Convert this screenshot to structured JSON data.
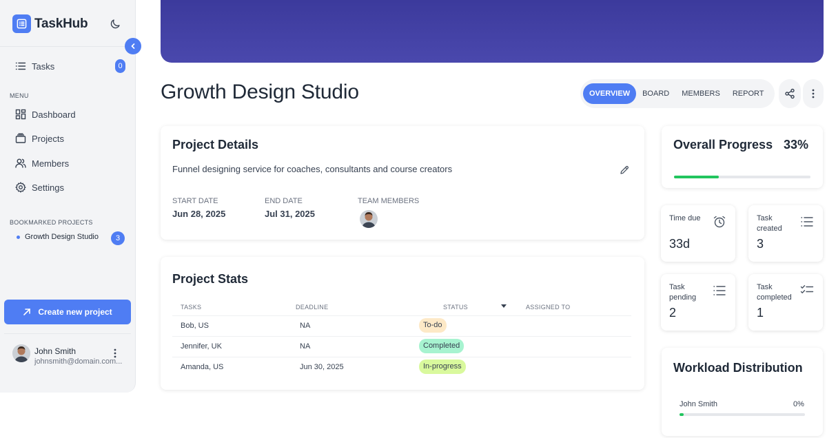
{
  "app": {
    "name": "TaskHub"
  },
  "sidebar": {
    "tasks": {
      "label": "Tasks",
      "count": "0"
    },
    "menu_label": "MENU",
    "menu_items": [
      {
        "label": "Dashboard",
        "icon": "dashboard-icon"
      },
      {
        "label": "Projects",
        "icon": "folder-icon"
      },
      {
        "label": "Members",
        "icon": "users-icon"
      },
      {
        "label": "Settings",
        "icon": "gear-icon"
      }
    ],
    "bookmarked_label": "BOOKMARKED PROJECTS",
    "bookmarks": [
      {
        "label": "Growth Design Studio",
        "count": "3"
      }
    ],
    "create_button": "Create new project",
    "user": {
      "name": "John Smith",
      "email": "johnsmith@domain.com..."
    }
  },
  "header": {
    "title": "Growth Design Studio",
    "tabs": [
      "OVERVIEW",
      "BOARD",
      "MEMBERS",
      "REPORT"
    ],
    "active_tab": "OVERVIEW"
  },
  "project_details": {
    "title": "Project Details",
    "description": "Funnel designing service for coaches, consultants and course creators",
    "start_label": "START DATE",
    "start_value": "Jun 28, 2025",
    "end_label": "END DATE",
    "end_value": "Jul 31, 2025",
    "team_label": "TEAM MEMBERS"
  },
  "project_stats": {
    "title": "Project Stats",
    "columns": [
      "TASKS",
      "DEADLINE",
      "STATUS",
      "ASSIGNED TO"
    ],
    "rows": [
      {
        "task": "Bob, US",
        "deadline": "NA",
        "status": "To-do",
        "status_color": "#fde9c7"
      },
      {
        "task": "Jennifer, UK",
        "deadline": "NA",
        "status": "Completed",
        "status_color": "#a7f3d0"
      },
      {
        "task": "Amanda, US",
        "deadline": "Jun 30, 2025",
        "status": "In-progress",
        "status_color": "#d9f99d"
      }
    ]
  },
  "overall_progress": {
    "title": "Overall Progress",
    "percent_text": "33%",
    "fraction": 0.33
  },
  "stats": [
    {
      "label": "Time due",
      "value": "33d",
      "icon": "alarm-clock-icon"
    },
    {
      "label": "Task created",
      "value": "3",
      "icon": "list-icon"
    },
    {
      "label": "Task pending",
      "value": "2",
      "icon": "list-icon"
    },
    {
      "label": "Task completed",
      "value": "1",
      "icon": "checklist-icon"
    }
  ],
  "workload": {
    "title": "Workload Distribution",
    "members": [
      {
        "name": "John Smith",
        "percent": "0%"
      }
    ]
  },
  "colors": {
    "accent": "#4f7df3",
    "banner": "#3f3da3",
    "progress": "#22c55e"
  }
}
